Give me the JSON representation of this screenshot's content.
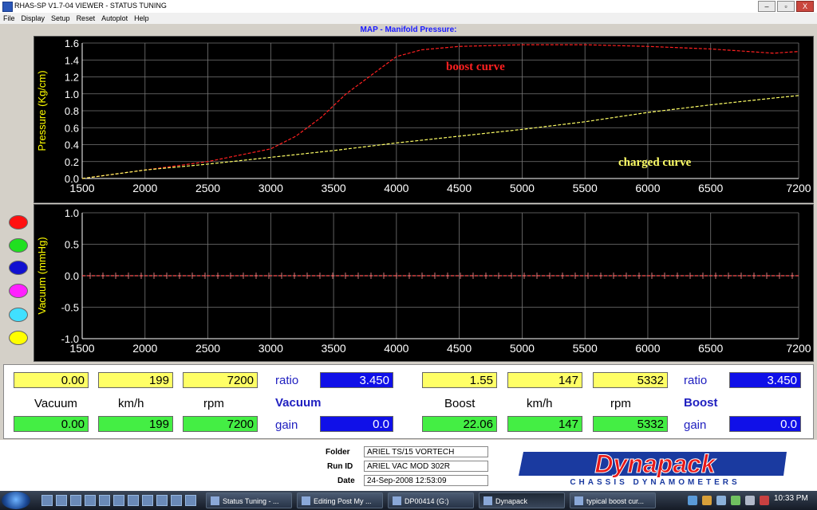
{
  "window": {
    "title": "RHAS-SP V1.7-04  VIEWER - STATUS TUNING",
    "buttons": [
      "–",
      "▫",
      "X"
    ]
  },
  "menu": [
    "File",
    "Display",
    "Setup",
    "Reset",
    "Autoplot",
    "Help"
  ],
  "chart_title": "MAP - Manifold Pressure:",
  "chart_data": [
    {
      "type": "line",
      "ylabel": "Pressure (Kg/cm)",
      "x_ticks": [
        "1500",
        "2000",
        "2500",
        "3000",
        "3500",
        "4000",
        "4500",
        "5000",
        "5500",
        "6000",
        "6500",
        "7200"
      ],
      "y_ticks": [
        "0.0",
        "0.2",
        "0.4",
        "0.6",
        "0.8",
        "1.0",
        "1.2",
        "1.4",
        "1.6"
      ],
      "xlim": [
        1500,
        7200
      ],
      "ylim": [
        0,
        1.6
      ],
      "grid": true,
      "series": [
        {
          "name": "boost curve",
          "color": "#ff2020",
          "x": [
            1500,
            2000,
            2500,
            3000,
            3200,
            3400,
            3600,
            3800,
            4000,
            4200,
            4500,
            5000,
            5500,
            6000,
            6500,
            6800,
            7000,
            7200
          ],
          "y": [
            0.0,
            0.1,
            0.2,
            0.35,
            0.5,
            0.72,
            1.0,
            1.22,
            1.44,
            1.52,
            1.56,
            1.58,
            1.58,
            1.56,
            1.53,
            1.5,
            1.48,
            1.5
          ]
        },
        {
          "name": "charged curve",
          "color": "#ffff66",
          "x": [
            1500,
            2000,
            2500,
            3000,
            3500,
            4000,
            4500,
            5000,
            5500,
            6000,
            6500,
            7000,
            7200
          ],
          "y": [
            0.0,
            0.1,
            0.17,
            0.25,
            0.33,
            0.42,
            0.5,
            0.58,
            0.67,
            0.78,
            0.87,
            0.95,
            0.98
          ]
        }
      ],
      "annotations": [
        "boost curve",
        "charged curve"
      ]
    },
    {
      "type": "line",
      "ylabel": "Vacuum (mmHg)",
      "x_ticks": [
        "1500",
        "2000",
        "2500",
        "3000",
        "3500",
        "4000",
        "4500",
        "5000",
        "5500",
        "6000",
        "6500",
        "7200"
      ],
      "y_ticks": [
        "1.0",
        "0.5",
        "0.0",
        "-0.5",
        "-1.0"
      ],
      "xlim": [
        1500,
        7200
      ],
      "ylim": [
        -1.0,
        1.0
      ],
      "grid": true,
      "series": [
        {
          "color": "#ff5050",
          "x": [
            1500,
            7200
          ],
          "y": [
            0.0,
            0.0
          ]
        }
      ]
    }
  ],
  "channel_colors": [
    "#ff1010",
    "#20e020",
    "#1010d0",
    "#ff20ff",
    "#40e0ff",
    "#ffff00"
  ],
  "readouts": {
    "vacuum_val": "0.00",
    "kmh_1": "199",
    "rpm_1": "7200",
    "ratio_label_1": "ratio",
    "ratio_val_1": "3.450",
    "boost_val": "1.55",
    "kmh_2": "147",
    "rpm_2": "5332",
    "ratio_label_2": "ratio",
    "ratio_val_2": "3.450",
    "label_vacuum": "Vacuum",
    "label_kmh_1": "km/h",
    "label_rpm_1": "rpm",
    "label_vacuum_blue": "Vacuum",
    "label_boost": "Boost",
    "label_kmh_2": "km/h",
    "label_rpm_2": "rpm",
    "label_boost_blue": "Boost",
    "vacuum_val_2": "0.00",
    "kmh_3": "199",
    "rpm_3": "7200",
    "gain_label_1": "gain",
    "gain_val_1": "0.0",
    "boost_val_2": "22.06",
    "kmh_4": "147",
    "rpm_4": "5332",
    "gain_label_2": "gain",
    "gain_val_2": "0.0"
  },
  "footer": {
    "folder_label": "Folder",
    "folder_value": "ARIEL TS/15 VORTECH",
    "runid_label": "Run ID",
    "runid_value": "ARIEL VAC MOD 302R",
    "date_label": "Date",
    "date_value": "24-Sep-2008  12:53:09"
  },
  "logo": {
    "brand": "Dynapack",
    "tagline": "CHASSIS DYNAMOMETERS"
  },
  "taskbar": {
    "buttons": [
      "Status Tuning - ...",
      "Editing Post My ...",
      "DP00414 (G:)",
      "Dynapack",
      "typical boost cur..."
    ],
    "clock": "10:33 PM"
  }
}
